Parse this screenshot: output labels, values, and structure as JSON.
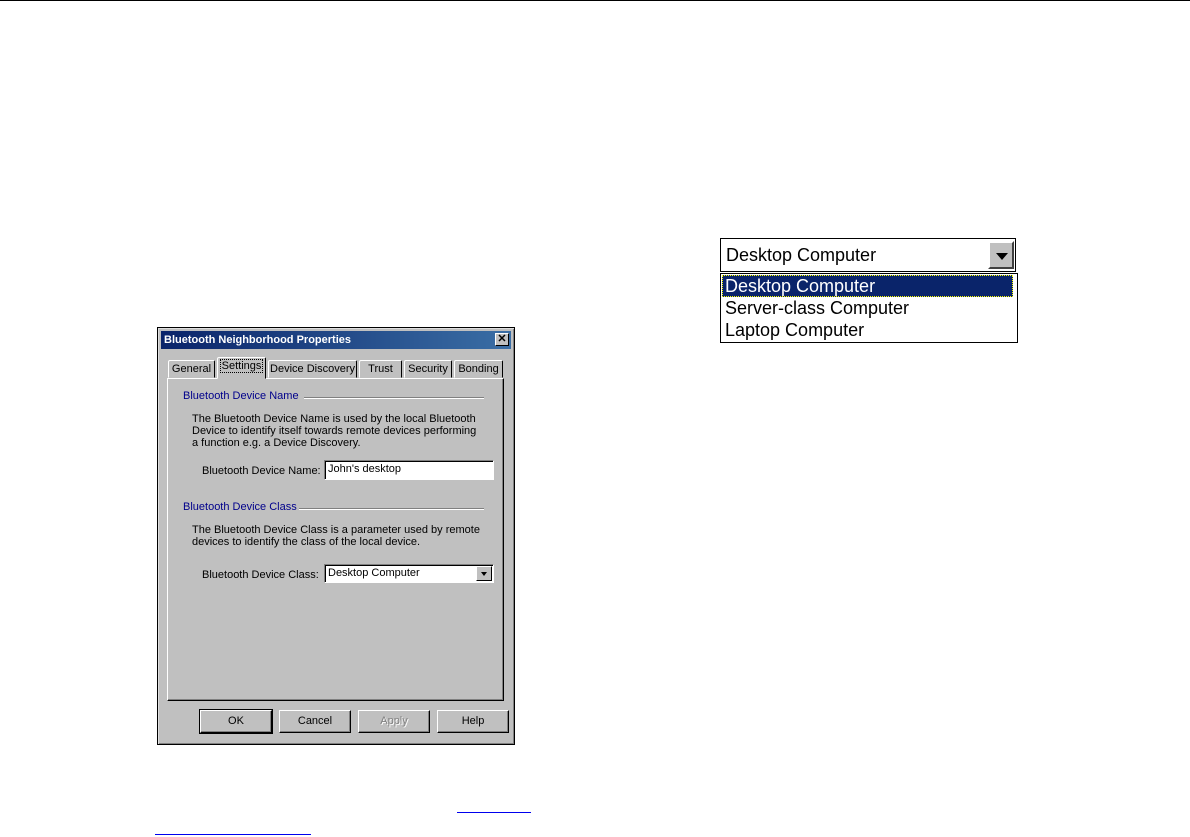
{
  "dialog": {
    "title": "Bluetooth Neighborhood Properties",
    "close_glyph": "✕",
    "tabs": [
      "General",
      "Settings",
      "Device Discovery",
      "Trust",
      "Security",
      "Bonding"
    ],
    "active_tab": "Settings",
    "device_name_group": {
      "title": "Bluetooth Device Name",
      "description": "The Bluetooth Device Name is used by the local Bluetooth Device to identify itself towards remote devices performing a function e.g. a Device Discovery.",
      "label": "Bluetooth Device Name:",
      "value": "John's desktop"
    },
    "device_class_group": {
      "title": "Bluetooth Device Class",
      "description": "The Bluetooth Device Class is a parameter used by remote devices to identify the class of the local device.",
      "label": "Bluetooth Device Class:",
      "value": "Desktop Computer"
    },
    "buttons": {
      "ok": "OK",
      "cancel": "Cancel",
      "apply": "Apply",
      "help": "Help"
    }
  },
  "enlarged_combo": {
    "value": "Desktop Computer",
    "options": [
      "Desktop Computer",
      "Server-class Computer",
      "Laptop Computer"
    ],
    "selected_index": 0
  },
  "colors": {
    "titlebar_start": "#0a246a",
    "titlebar_end": "#3a6ea5",
    "group_title": "#00008b",
    "selection": "#0a246a",
    "face": "#c0c0c0"
  }
}
